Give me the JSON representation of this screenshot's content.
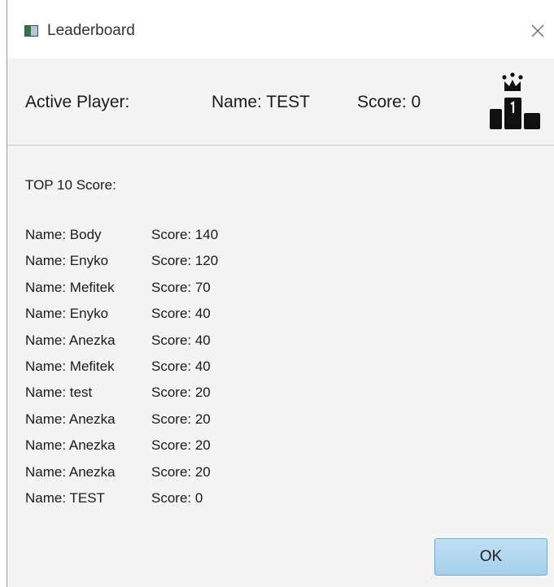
{
  "window": {
    "title": "Leaderboard"
  },
  "active_player": {
    "label": "Active Player:",
    "name": "Name: TEST",
    "score": "Score: 0"
  },
  "leaderboard": {
    "title": "TOP 10 Score:",
    "rows": [
      {
        "name": "Name: Body",
        "score": "Score: 140"
      },
      {
        "name": "Name: Enyko",
        "score": "Score: 120"
      },
      {
        "name": "Name: Mefitek",
        "score": "Score: 70"
      },
      {
        "name": "Name: Enyko",
        "score": "Score: 40"
      },
      {
        "name": "Name: Anezka",
        "score": "Score: 40"
      },
      {
        "name": "Name: Mefitek",
        "score": "Score: 40"
      },
      {
        "name": "Name: test",
        "score": "Score: 20"
      },
      {
        "name": "Name: Anezka",
        "score": "Score: 20"
      },
      {
        "name": "Name: Anezka",
        "score": "Score: 20"
      },
      {
        "name": "Name: Anezka",
        "score": "Score: 20"
      },
      {
        "name": "Name: TEST",
        "score": "Score: 0"
      }
    ]
  },
  "buttons": {
    "ok_label": "OK"
  },
  "icons": {
    "app": "app-window-icon",
    "close": "close-icon",
    "leader": "podium-crown-icon"
  },
  "colors": {
    "ok_button": "#a6d0ec",
    "background": "#f4f4f4"
  }
}
